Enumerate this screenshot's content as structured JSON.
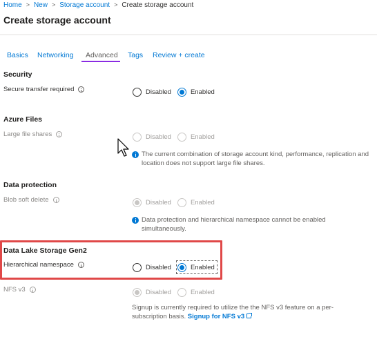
{
  "breadcrumb": {
    "items": [
      "Home",
      "New",
      "Storage account"
    ],
    "current": "Create storage account"
  },
  "page_title": "Create storage account",
  "tabs": [
    {
      "label": "Basics",
      "active": false
    },
    {
      "label": "Networking",
      "active": false
    },
    {
      "label": "Advanced",
      "active": true
    },
    {
      "label": "Tags",
      "active": false
    },
    {
      "label": "Review + create",
      "active": false
    }
  ],
  "security": {
    "title": "Security",
    "secure_transfer": {
      "label": "Secure transfer required",
      "options": [
        "Disabled",
        "Enabled"
      ],
      "selected": "Enabled"
    }
  },
  "azure_files": {
    "title": "Azure Files",
    "large_file_shares": {
      "label": "Large file shares",
      "options": [
        "Disabled",
        "Enabled"
      ],
      "selected": null,
      "note": "The current combination of storage account kind, performance, replication and location does not support large file shares."
    }
  },
  "data_protection": {
    "title": "Data protection",
    "blob_soft_delete": {
      "label": "Blob soft delete",
      "options": [
        "Disabled",
        "Enabled"
      ],
      "selected": "Disabled",
      "note": "Data protection and hierarchical namespace cannot be enabled simultaneously."
    }
  },
  "data_lake": {
    "title": "Data Lake Storage Gen2",
    "hierarchical_namespace": {
      "label": "Hierarchical namespace",
      "options": [
        "Disabled",
        "Enabled"
      ],
      "selected": "Enabled"
    },
    "nfs_v3": {
      "label": "NFS v3",
      "options": [
        "Disabled",
        "Enabled"
      ],
      "selected": "Disabled",
      "note": "Signup is currently required to utilize the the NFS v3 feature on a per-subscription basis.",
      "link": "Signup for NFS v3"
    }
  },
  "colors": {
    "accent": "#0078d4",
    "active_tab_underline": "#8a2be2",
    "highlight": "#e04848"
  }
}
